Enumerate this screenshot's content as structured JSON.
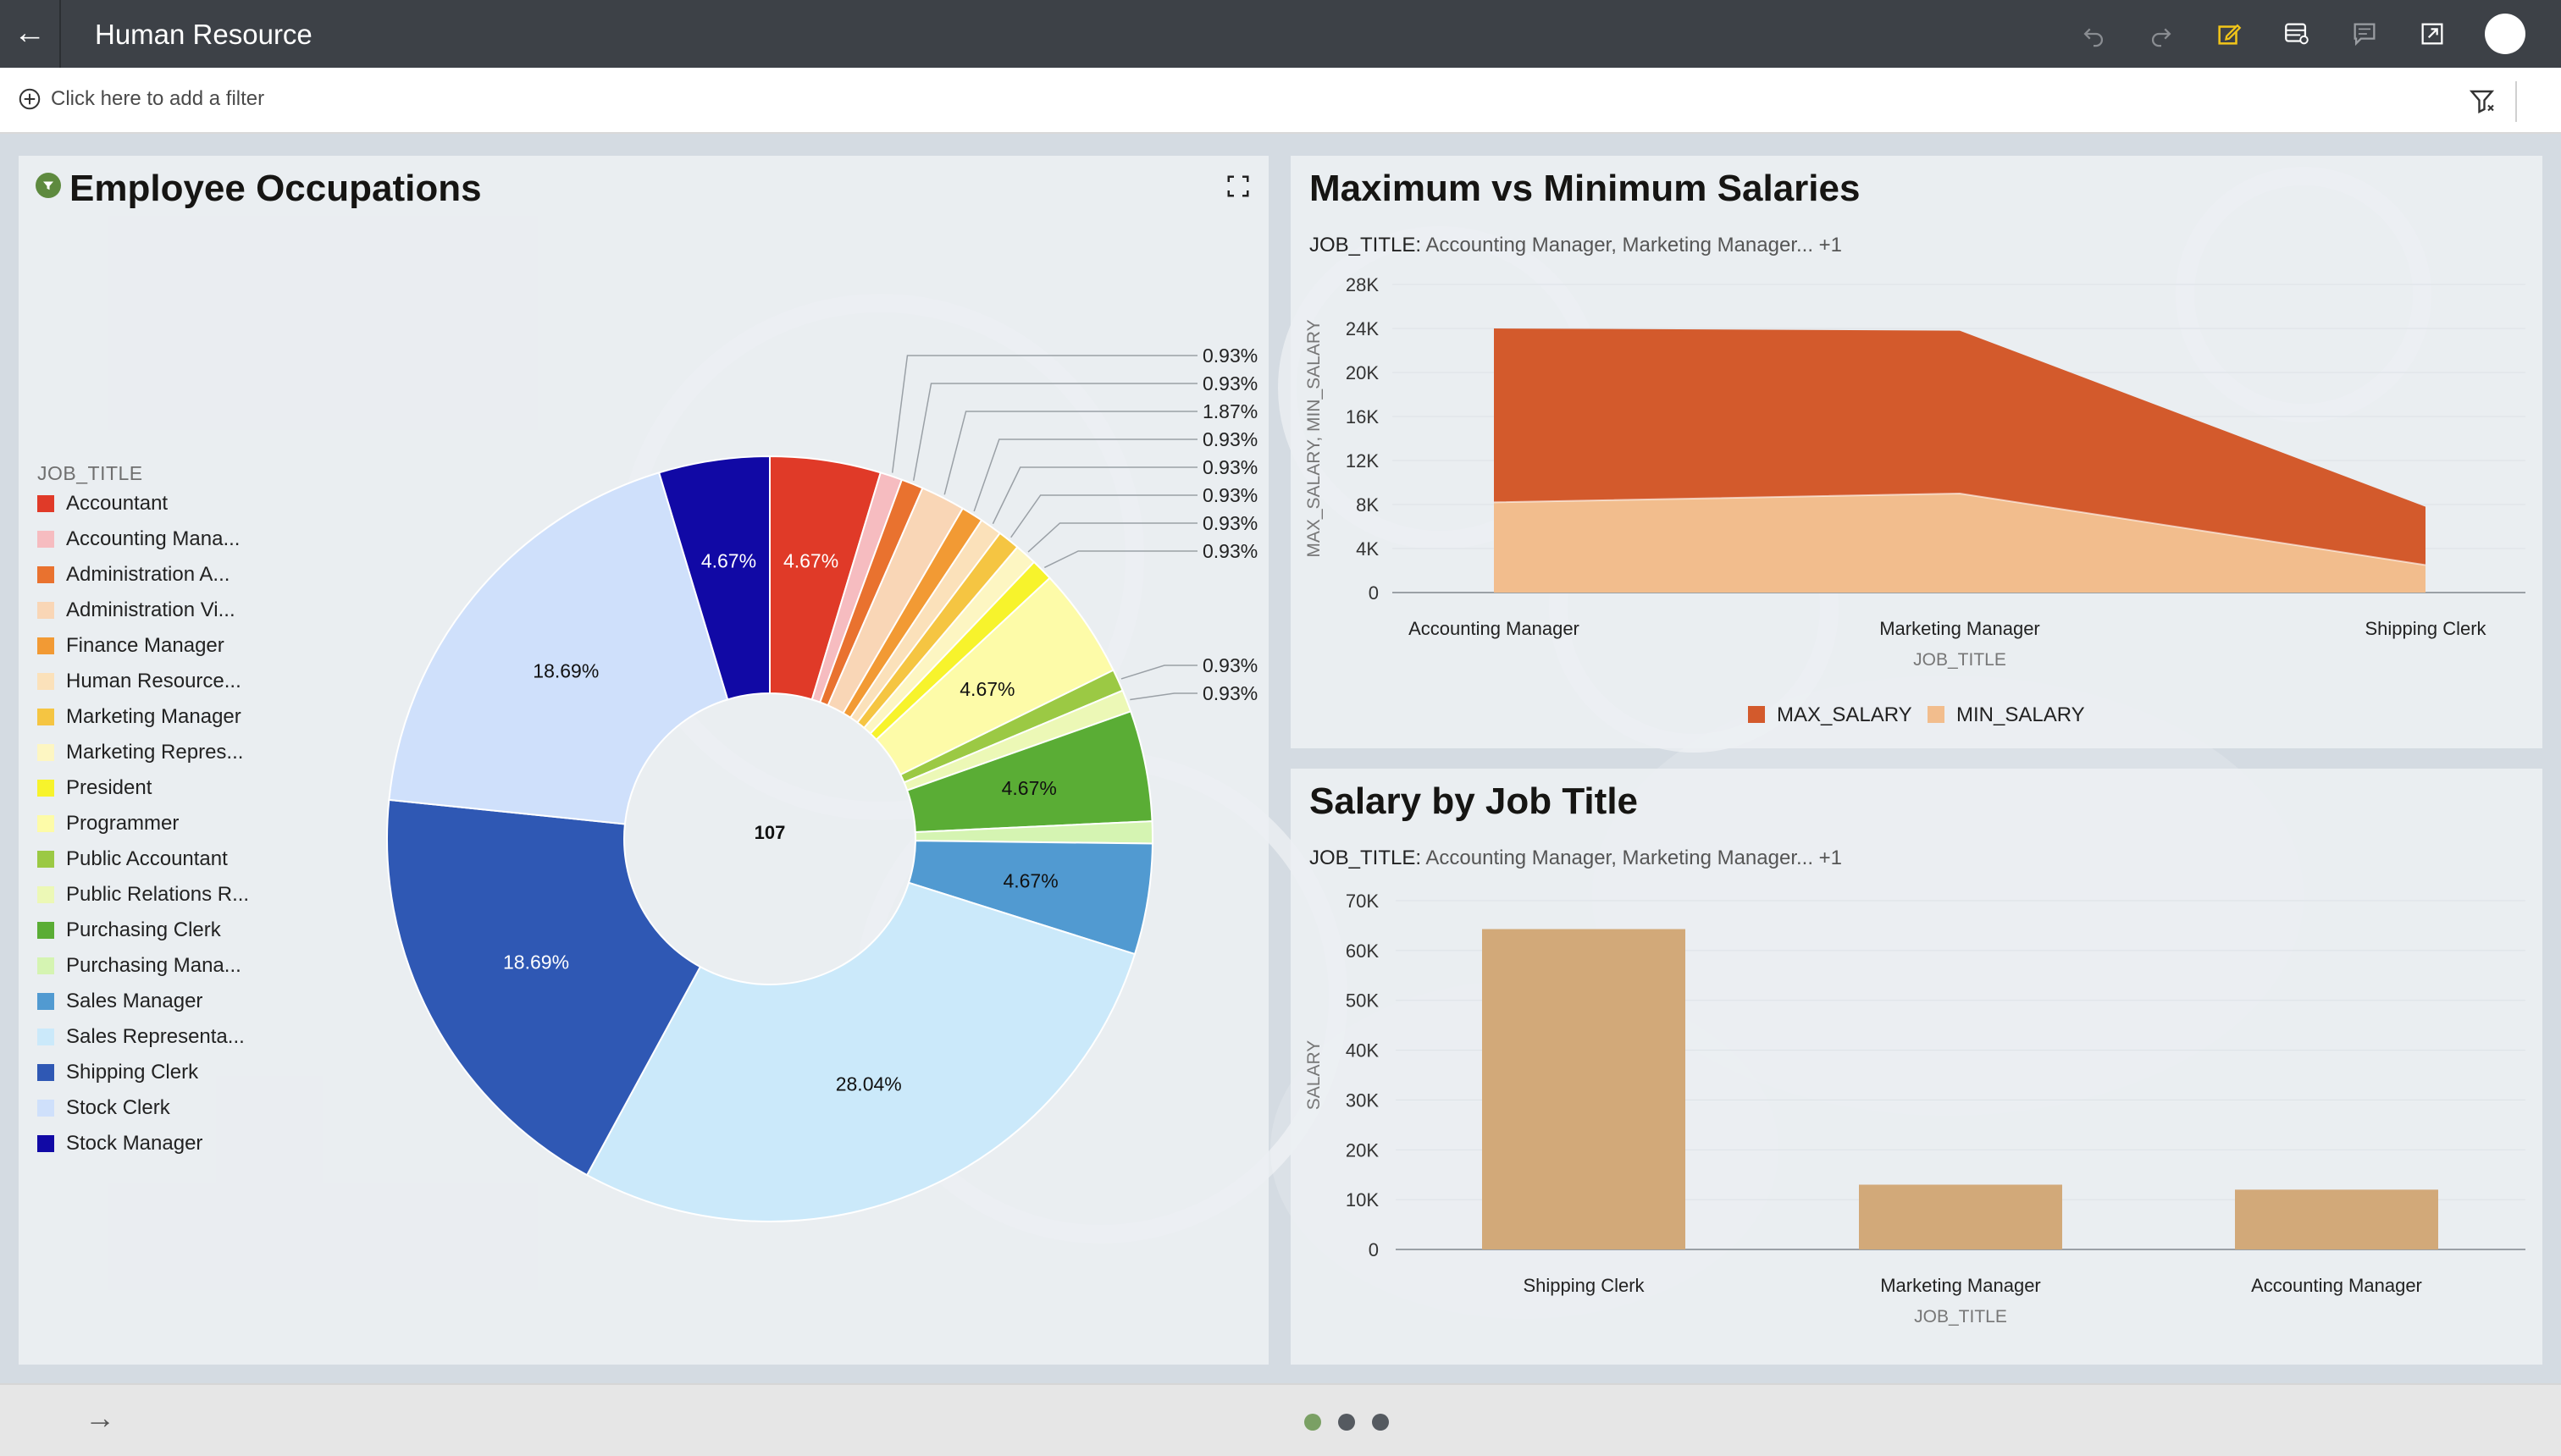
{
  "header": {
    "back_icon": "arrow-left-icon",
    "title": "Human Resource",
    "tools": [
      "undo-icon",
      "redo-icon",
      "edit-icon",
      "data-icon",
      "comment-icon",
      "present-icon"
    ]
  },
  "filter_bar": {
    "placeholder": "Click here to add a filter",
    "add_icon": "plus-circle-icon",
    "funnel_icon": "filter-icon"
  },
  "employee_occupations": {
    "title": "Employee Occupations",
    "legend_title": "JOB_TITLE",
    "center_total": "107",
    "legend": [
      {
        "label": "Accountant",
        "color": "#e03a28"
      },
      {
        "label": "Accounting Mana...",
        "color": "#f6bcc0"
      },
      {
        "label": "Administration A...",
        "color": "#e9722f"
      },
      {
        "label": "Administration Vi...",
        "color": "#f9d6b6"
      },
      {
        "label": "Finance Manager",
        "color": "#f29a34"
      },
      {
        "label": "Human Resource...",
        "color": "#fbe1ba"
      },
      {
        "label": "Marketing Manager",
        "color": "#f5c542"
      },
      {
        "label": "Marketing Repres...",
        "color": "#fdf6c2"
      },
      {
        "label": "President",
        "color": "#f7f32c"
      },
      {
        "label": "Programmer",
        "color": "#fdfba8"
      },
      {
        "label": "Public Accountant",
        "color": "#9bc944"
      },
      {
        "label": "Public Relations R...",
        "color": "#ecf8b6"
      },
      {
        "label": "Purchasing Clerk",
        "color": "#5aad35"
      },
      {
        "label": "Purchasing Mana...",
        "color": "#d5f4b2"
      },
      {
        "label": "Sales Manager",
        "color": "#519ad1"
      },
      {
        "label": "Sales Representa...",
        "color": "#cbe9fa"
      },
      {
        "label": "Shipping Clerk",
        "color": "#2f58b4"
      },
      {
        "label": "Stock Clerk",
        "color": "#cfe0fb"
      },
      {
        "label": "Stock Manager",
        "color": "#1109a5"
      }
    ]
  },
  "max_min": {
    "title": "Maximum vs Minimum Salaries",
    "filter_key": "JOB_TITLE:",
    "filter_value": "Accounting Manager, Marketing Manager... +1"
  },
  "salary_by_job": {
    "title": "Salary by Job Title",
    "filter_key": "JOB_TITLE:",
    "filter_value": "Accounting Manager, Marketing Manager... +1"
  },
  "footer": {
    "arrow_icon": "arrow-right-icon",
    "pages": 3,
    "active_page": 0
  },
  "chart_data": [
    {
      "type": "pie",
      "title": "Employee Occupations",
      "donut": true,
      "center_label": "107",
      "categories": [
        "Accountant",
        "Accounting Manager",
        "Administration Assistant",
        "Administration Vice President",
        "Finance Manager",
        "Human Resources Representative",
        "Marketing Manager",
        "Marketing Representative",
        "President",
        "Programmer",
        "Public Accountant",
        "Public Relations Representative",
        "Purchasing Clerk",
        "Purchasing Manager",
        "Sales Manager",
        "Sales Representative",
        "Shipping Clerk",
        "Stock Clerk",
        "Stock Manager"
      ],
      "values": [
        4.67,
        0.93,
        0.93,
        1.87,
        0.93,
        0.93,
        0.93,
        0.93,
        0.93,
        4.67,
        0.93,
        0.93,
        4.67,
        0.93,
        4.67,
        28.04,
        18.69,
        18.69,
        4.67
      ],
      "value_labels": [
        "4.67%",
        "0.93%",
        "0.93%",
        "1.87%",
        "0.93%",
        "0.93%",
        "0.93%",
        "0.93%",
        "0.93%",
        "4.67%",
        "0.93%",
        "0.93%",
        "4.67%",
        "0.93%",
        "4.67%",
        "28.04%",
        "18.69%",
        "18.69%",
        "4.67%"
      ],
      "colors": [
        "#e03a28",
        "#f6bcc0",
        "#e9722f",
        "#f9d6b6",
        "#f29a34",
        "#fbe1ba",
        "#f5c542",
        "#fdf6c2",
        "#f7f32c",
        "#fdfba8",
        "#9bc944",
        "#ecf8b6",
        "#5aad35",
        "#d5f4b2",
        "#519ad1",
        "#cbe9fa",
        "#2f58b4",
        "#cfe0fb",
        "#1109a5"
      ],
      "legend_title": "JOB_TITLE",
      "legend": "left"
    },
    {
      "type": "area",
      "title": "Maximum vs Minimum Salaries",
      "categories": [
        "Accounting Manager",
        "Marketing Manager",
        "Shipping Clerk"
      ],
      "series": [
        {
          "name": "MAX_SALARY",
          "values": [
            24000,
            23800,
            7800
          ],
          "color": "#d35a2c"
        },
        {
          "name": "MIN_SALARY",
          "values": [
            8200,
            9000,
            2500
          ],
          "color": "#f2bd8d"
        }
      ],
      "xlabel": "JOB_TITLE",
      "ylabel": "MAX_SALARY, MIN_SALARY",
      "ylim": [
        0,
        28000
      ],
      "yticks": [
        0,
        4000,
        8000,
        12000,
        16000,
        20000,
        24000,
        28000
      ],
      "ytick_labels": [
        "0",
        "4K",
        "8K",
        "12K",
        "16K",
        "20K",
        "24K",
        "28K"
      ],
      "legend": "bottom"
    },
    {
      "type": "bar",
      "title": "Salary by Job Title",
      "categories": [
        "Shipping Clerk",
        "Marketing Manager",
        "Accounting Manager"
      ],
      "values": [
        64300,
        13000,
        12000
      ],
      "color": "#d2a979",
      "xlabel": "JOB_TITLE",
      "ylabel": "SALARY",
      "ylim": [
        0,
        70000
      ],
      "yticks": [
        0,
        10000,
        20000,
        30000,
        40000,
        50000,
        60000,
        70000
      ],
      "ytick_labels": [
        "0",
        "10K",
        "20K",
        "30K",
        "40K",
        "50K",
        "60K",
        "70K"
      ]
    }
  ]
}
